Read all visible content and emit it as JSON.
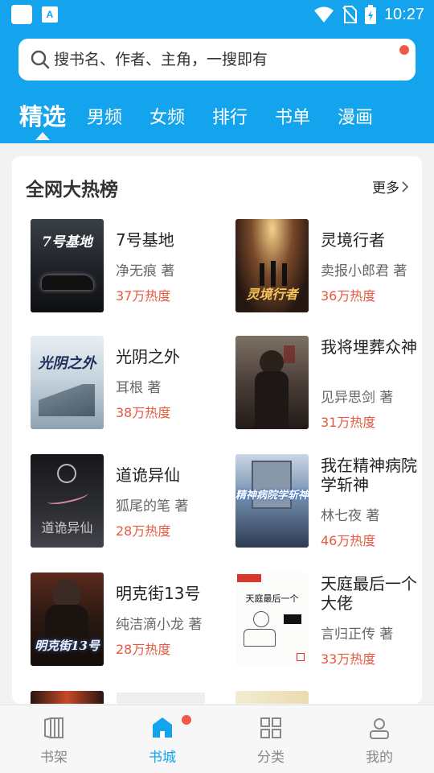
{
  "status_bar": {
    "time": "10:27",
    "notif_letter": "A"
  },
  "search": {
    "placeholder": "搜书名、作者、主角，一搜即有"
  },
  "tabs": [
    {
      "label": "精选",
      "active": true
    },
    {
      "label": "男频"
    },
    {
      "label": "女频"
    },
    {
      "label": "排行"
    },
    {
      "label": "书单"
    },
    {
      "label": "漫画"
    }
  ],
  "section": {
    "title": "全网大热榜",
    "more_label": "更多"
  },
  "books": [
    {
      "title": "7号基地",
      "author": "净无痕 著",
      "heat": "37万热度",
      "cover_text": "7号基地"
    },
    {
      "title": "灵境行者",
      "author": "卖报小郎君 著",
      "heat": "36万热度",
      "cover_text": "灵境行者"
    },
    {
      "title": "光阴之外",
      "author": "耳根 著",
      "heat": "38万热度",
      "cover_text": "光阴之外"
    },
    {
      "title": "我将埋葬众神",
      "author": "见异思剑 著",
      "heat": "31万热度",
      "cover_text": ""
    },
    {
      "title": "道诡异仙",
      "author": "狐尾的笔 著",
      "heat": "28万热度",
      "cover_text": "道诡异仙"
    },
    {
      "title": "我在精神病院学斩神",
      "author": "林七夜 著",
      "heat": "46万热度",
      "cover_text": "精神病院学斩神"
    },
    {
      "title": "明克街13号",
      "author": "纯洁滴小龙 著",
      "heat": "28万热度",
      "cover_text": "明克街13号"
    },
    {
      "title": "天庭最后一个大佬",
      "author": "言归正传 著",
      "heat": "33万热度",
      "cover_text": "天庭最后一个"
    }
  ],
  "bottom_nav": [
    {
      "label": "书架",
      "icon": "bookshelf-icon"
    },
    {
      "label": "书城",
      "icon": "bookstore-icon",
      "active": true
    },
    {
      "label": "分类",
      "icon": "category-icon"
    },
    {
      "label": "我的",
      "icon": "profile-icon"
    }
  ],
  "colors": {
    "primary": "#14a4ee",
    "heat": "#e8583f",
    "badge": "#f2584a"
  }
}
